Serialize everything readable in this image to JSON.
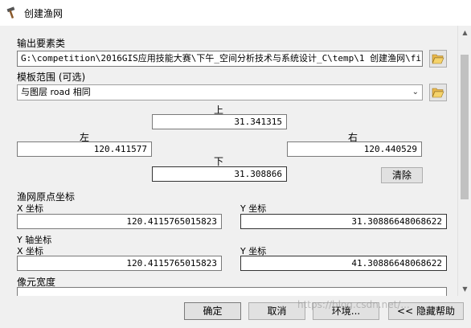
{
  "window": {
    "title": "创建渔网"
  },
  "output": {
    "label": "输出要素类",
    "value": "G:\\competition\\2016GIS应用技能大赛\\下午_空间分析技术与系统设计_C\\temp\\1 创建渔网\\fi"
  },
  "template": {
    "label": "模板范围 (可选)",
    "selected": "与图层 road 相同"
  },
  "extent": {
    "top_label": "上",
    "top_value": "31.341315",
    "left_label": "左",
    "left_value": "120.411577",
    "right_label": "右",
    "right_value": "120.440529",
    "bottom_label": "下",
    "bottom_value": "31.308866",
    "clear_label": "清除"
  },
  "origin": {
    "label": "渔网原点坐标",
    "x_label": "X 坐标",
    "x_value": "120.4115765015823",
    "y_label": "Y 坐标",
    "y_value": "31.30886648068622"
  },
  "yaxis": {
    "label": "Y 轴坐标",
    "x_label": "X 坐标",
    "x_value": "120.4115765015823",
    "y_label": "Y 坐标",
    "y_value": "41.30886648068622"
  },
  "cell_width": {
    "label": "像元宽度"
  },
  "footer": {
    "ok": "确定",
    "cancel": "取消",
    "env": "环境...",
    "hide_help": "<< 隐藏帮助"
  },
  "watermark": "https://blog.csdn.net/..."
}
